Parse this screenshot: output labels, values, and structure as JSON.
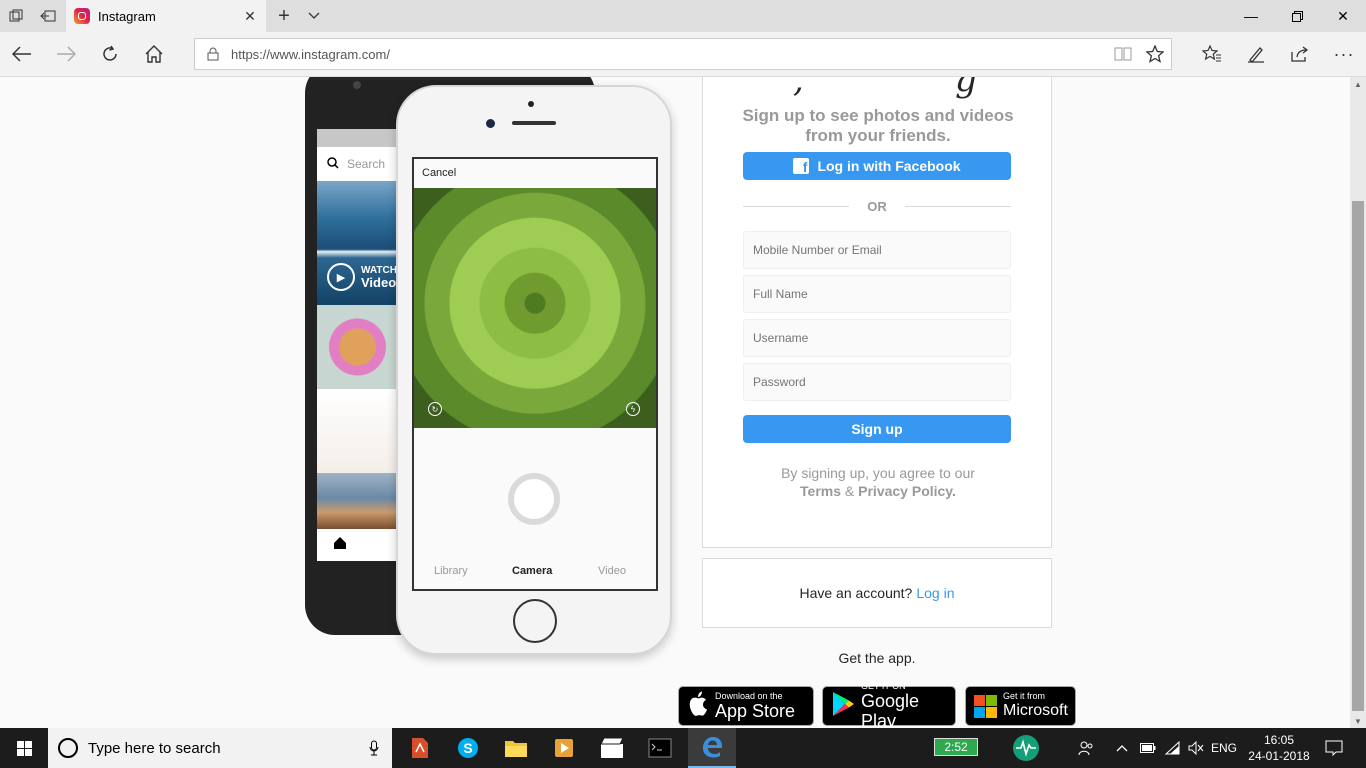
{
  "browser": {
    "tab_title": "Instagram",
    "url": "https://www.instagram.com/"
  },
  "phones": {
    "back": {
      "search_placeholder": "Search",
      "watch_label": "WATCH",
      "video_label": "Video"
    },
    "front": {
      "cancel_label": "Cancel",
      "tabs": [
        "Library",
        "Camera",
        "Video"
      ],
      "active_tab": "Camera"
    }
  },
  "signup": {
    "tagline": "Sign up to see photos and videos from your friends.",
    "facebook_button": "Log in with Facebook",
    "or_label": "OR",
    "fields": {
      "mobile_placeholder": "Mobile Number or Email",
      "fullname_placeholder": "Full Name",
      "username_placeholder": "Username",
      "password_placeholder": "Password"
    },
    "signup_button": "Sign up",
    "terms_prefix": "By signing up, you agree to our",
    "terms_link": "Terms",
    "terms_amp": "&",
    "privacy_link": "Privacy Policy."
  },
  "login_box": {
    "prompt": "Have an account?",
    "link": "Log in"
  },
  "get_app": {
    "label": "Get the app.",
    "app_store": {
      "small": "Download on the",
      "big": "App Store"
    },
    "google_play": {
      "small": "GET IT ON",
      "big": "Google Play"
    },
    "microsoft": {
      "small": "Get it from",
      "big": "Microsoft"
    }
  },
  "taskbar": {
    "search_placeholder": "Type here to search",
    "battery_widget": "2:52",
    "language": "ENG",
    "time": "16:05",
    "date": "24-01-2018"
  },
  "colors": {
    "accent": "#3897f0",
    "page_bg": "#fafafa",
    "taskbar_bg": "#1c1c1c"
  }
}
